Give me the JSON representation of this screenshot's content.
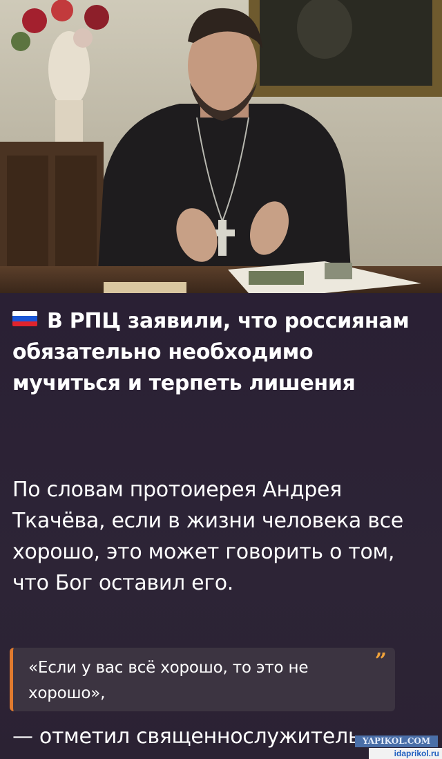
{
  "post": {
    "headline": "В РПЦ заявили, что россиянам обязательно необходимо мучиться и терпеть лишения",
    "flag_colors": [
      "#ffffff",
      "#1c57d6",
      "#e0242c"
    ],
    "body": "По словам протоиерея Андрея Ткачёва, если в жизни человека все хорошо, это может говорить о том, что Бог оставил его.",
    "quote": "«Если у вас всё хорошо, то это не хорошо»,",
    "quote_mark": "”",
    "closing": "— отметил священнослужитель"
  },
  "watermark": {
    "top": "YAPIKOL.COM",
    "bottom": "idaprikol.ru"
  },
  "colors": {
    "background": "#2b2235",
    "quote_bg": "#3c3441",
    "quote_accent": "#e07a2e"
  }
}
